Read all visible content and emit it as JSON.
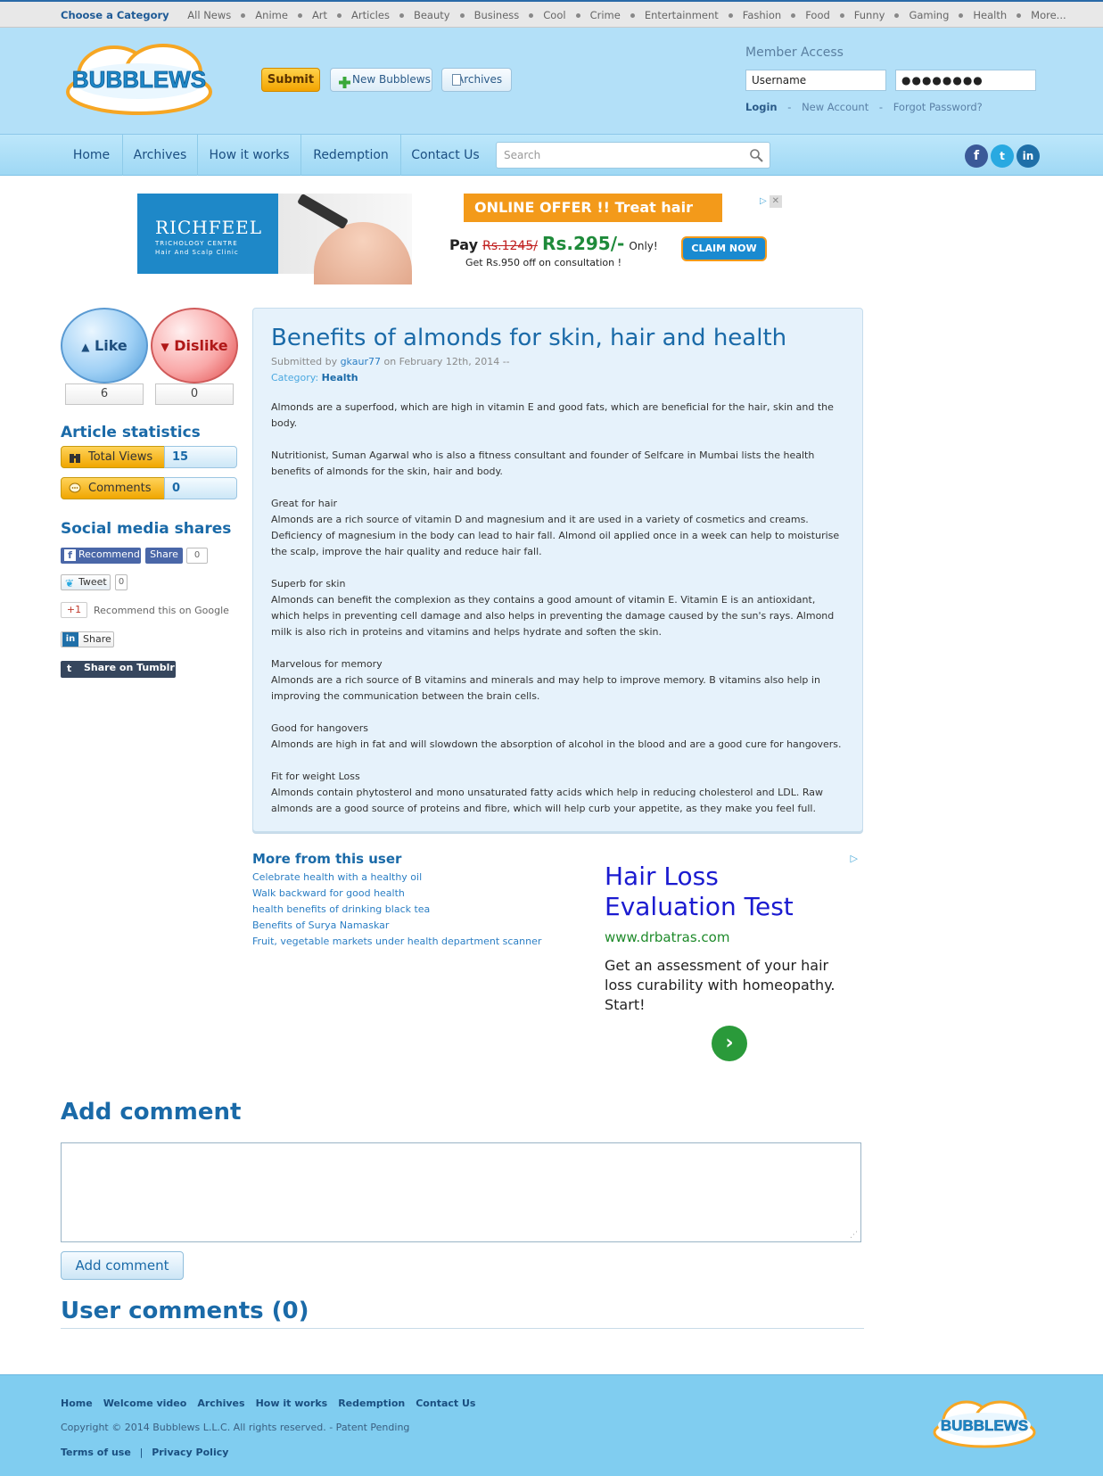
{
  "categories": {
    "label": "Choose a Category",
    "items": [
      "All News",
      "Anime",
      "Art",
      "Articles",
      "Beauty",
      "Business",
      "Cool",
      "Crime",
      "Entertainment",
      "Fashion",
      "Food",
      "Funny",
      "Gaming",
      "Health",
      "More..."
    ]
  },
  "header": {
    "logo_text": "BUBBLEWS",
    "submit_label": "Submit",
    "new_bubblews_label": "New Bubblews",
    "archives_label": "Archives",
    "member_title": "Member Access",
    "username_value": "Username",
    "password_value": "●●●●●●●●",
    "login_label": "Login",
    "new_account_label": "New Account",
    "forgot_label": "Forgot Password?",
    "sep": "-"
  },
  "nav": {
    "items": [
      "Home",
      "Archives",
      "How it works",
      "Redemption",
      "Contact Us"
    ],
    "search_placeholder": "Search",
    "social": [
      "f",
      "t",
      "in"
    ]
  },
  "ad_banner": {
    "brand": "RICHFEEL",
    "brand_sub": "TRICHOLOGY CENTRE",
    "brand_sub2": "Hair And Scalp Clinic",
    "offer": "ONLINE OFFER !!  Treat hair loss NOW !",
    "pay_label": "Pay",
    "old_price": "Rs.1245/",
    "new_price": "Rs.295/-",
    "only": "Only!",
    "get_text": "Get Rs.950 off on consultation !",
    "claim": "CLAIM NOW"
  },
  "votes": {
    "like_label": "Like",
    "dislike_label": "Dislike",
    "like_count": "6",
    "dislike_count": "0"
  },
  "stats": {
    "title": "Article statistics",
    "views_label": "Total Views",
    "views_value": "15",
    "comments_label": "Comments",
    "comments_value": "0"
  },
  "social_shares": {
    "title": "Social media shares",
    "recommend": "Recommend",
    "share": "Share",
    "fb_count": "0",
    "tweet": "Tweet",
    "tweet_count": "0",
    "gplus": "+1",
    "gplus_text": "Recommend this on Google",
    "linkedin_share": "Share",
    "tumblr": "Share on Tumblr"
  },
  "article": {
    "title": "Benefits of almonds for skin, hair and health",
    "submitted_by": "Submitted by",
    "author": "gkaur77",
    "date": "on February 12th, 2014 --",
    "category_label": "Category:",
    "category": "Health",
    "paragraphs": [
      "Almonds are a superfood, which are high in vitamin E and good fats, which are beneficial for the hair, skin and the body.",
      "Nutritionist, Suman Agarwal who is also a fitness consultant and founder of Selfcare in Mumbai lists the health benefits of almonds for the skin, hair and body.",
      "Great for hair\nAlmonds are a rich source of vitamin D and magnesium and it are used in a variety of cosmetics and creams. Deficiency of magnesium in the body can lead to hair fall. Almond oil applied once in a week can help to moisturise the scalp, improve the hair quality and reduce hair fall.",
      "Superb for skin\nAlmonds can benefit the complexion as they contains a good amount of vitamin E. Vitamin E is an antioxidant, which helps in preventing cell damage and also helps in preventing the damage caused by the sun's rays. Almond milk is also rich in proteins and vitamins and helps hydrate and soften the skin.",
      "Marvelous for memory\nAlmonds are a rich source of B vitamins and minerals and may help to improve memory. B vitamins also help in improving the communication between the brain cells.",
      "Good for hangovers\nAlmonds are high in fat and will slowdown the absorption of alcohol in the blood and are a good cure for hangovers.",
      "Fit for weight Loss\nAlmonds contain phytosterol and mono unsaturated fatty acids which help in reducing cholesterol and LDL. Raw almonds are a good source of proteins and fibre, which will help curb your appetite, as they make you feel full."
    ]
  },
  "more_from_user": {
    "title": "More from this user",
    "links": [
      "Celebrate health with a healthy oil",
      "Walk backward for good health",
      "health benefits of drinking black tea",
      "Benefits of Surya Namaskar",
      "Fruit, vegetable markets under health department scanner"
    ]
  },
  "ad_side": {
    "headline": "Hair Loss Evaluation Test",
    "url": "www.drbatras.com",
    "desc": "Get an assessment of your hair loss curability with homeopathy. Start!"
  },
  "comments": {
    "add_title": "Add comment",
    "add_button": "Add comment",
    "user_comments_title": "User comments (0)"
  },
  "footer": {
    "links": [
      "Home",
      "Welcome video",
      "Archives",
      "How it works",
      "Redemption",
      "Contact Us"
    ],
    "copyright": "Copyright © 2014 Bubblews L.L.C. All rights reserved. - Patent Pending",
    "terms": "Terms of use",
    "privacy": "Privacy Policy",
    "sep": "|"
  },
  "colors": {
    "header_bg": "#b3e0f8",
    "accent": "#1a6aa8",
    "footer_bg": "#80cdf0",
    "submit": "#f3a400"
  }
}
